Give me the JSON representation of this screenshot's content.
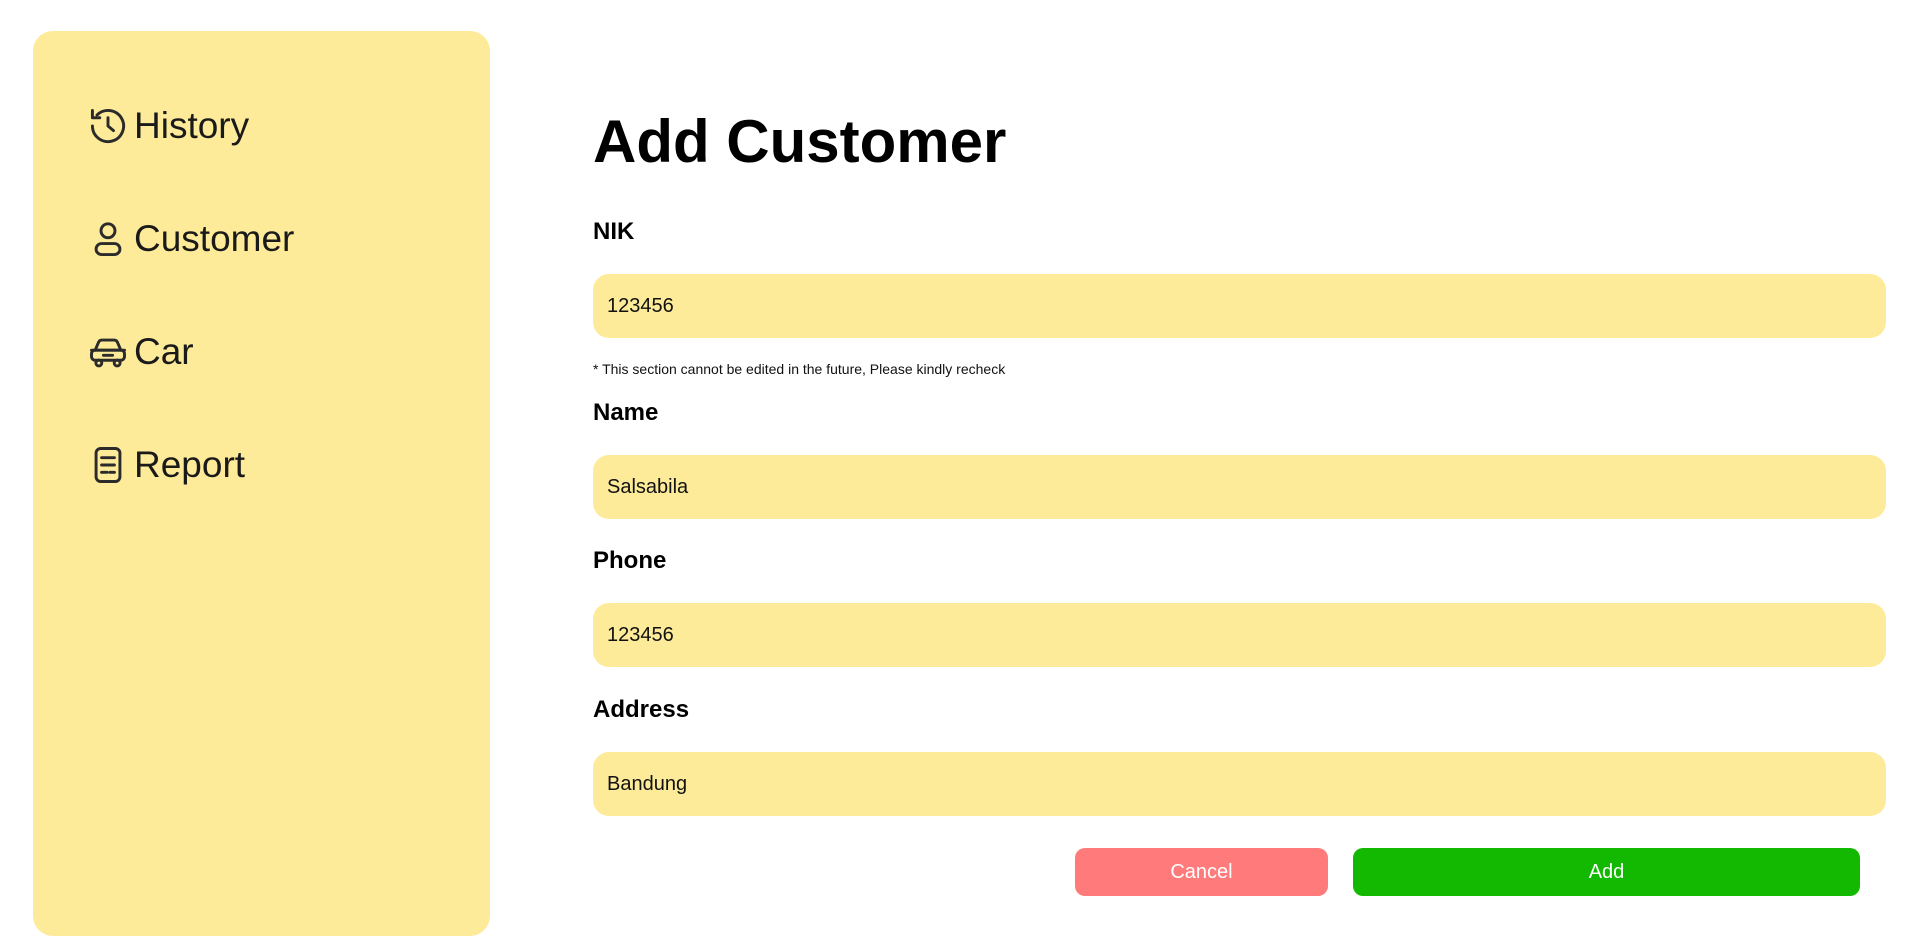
{
  "sidebar": {
    "items": [
      {
        "label": "History",
        "icon": "history-icon"
      },
      {
        "label": "Customer",
        "icon": "user-icon"
      },
      {
        "label": "Car",
        "icon": "car-icon"
      },
      {
        "label": "Report",
        "icon": "report-icon"
      }
    ]
  },
  "main": {
    "title": "Add Customer",
    "fields": {
      "nik": {
        "label": "NIK",
        "value": "123456"
      },
      "name": {
        "label": "Name",
        "value": "Salsabila"
      },
      "phone": {
        "label": "Phone",
        "value": "123456"
      },
      "address": {
        "label": "Address",
        "value": "Bandung"
      }
    },
    "nik_note": "* This section cannot be edited in the future, Please kindly recheck",
    "cancel_label": "Cancel",
    "add_label": "Add"
  },
  "colors": {
    "panel": "#fdeb99",
    "cancel": "#ff7a7a",
    "add": "#12b900"
  }
}
